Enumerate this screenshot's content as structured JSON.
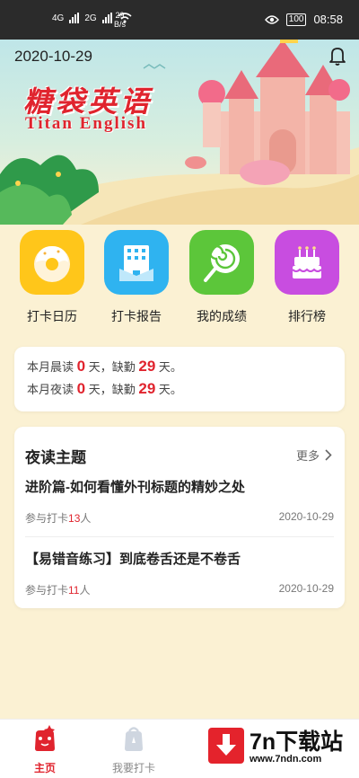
{
  "status_bar": {
    "signal1_label": "4G",
    "signal2_label": "2G",
    "net_speed_value": "29",
    "net_speed_unit": "B/s",
    "battery": "100",
    "time": "08:58"
  },
  "header": {
    "date": "2020-10-29",
    "logo_cn": "糖袋英语",
    "logo_en": "Titan English"
  },
  "shortcuts": [
    {
      "label": "打卡日历",
      "icon": "donut-icon",
      "color": "#ffc61a"
    },
    {
      "label": "打卡报告",
      "icon": "building-icon",
      "color": "#2fb3f0"
    },
    {
      "label": "我的成绩",
      "icon": "lollipop-icon",
      "color": "#5cc63a"
    },
    {
      "label": "排行榜",
      "icon": "cake-icon",
      "color": "#c84de0"
    }
  ],
  "monthly": {
    "morning_prefix": "本月晨读",
    "morning_days": "0",
    "mid": "天，缺勤",
    "morning_absent": "29",
    "suffix": "天。",
    "night_prefix": "本月夜读",
    "night_days": "0",
    "night_absent": "29"
  },
  "night_topic": {
    "title": "夜读主题",
    "more": "更多",
    "participate_prefix": "参与打卡",
    "participate_suffix": "人",
    "articles": [
      {
        "title": "进阶篇-如何看懂外刊标题的精妙之处",
        "count": "13",
        "date": "2020-10-29"
      },
      {
        "title": "【易错音练习】到底卷舌还是不卷舌",
        "count": "11",
        "date": "2020-10-29"
      }
    ]
  },
  "bottom_nav": {
    "home": "主页",
    "checkin": "我要打卡"
  },
  "watermark": {
    "text": "7n下载站",
    "url": "www.7ndn.com"
  },
  "colors": {
    "accent": "#e0242e",
    "background": "#fbf1d3"
  }
}
